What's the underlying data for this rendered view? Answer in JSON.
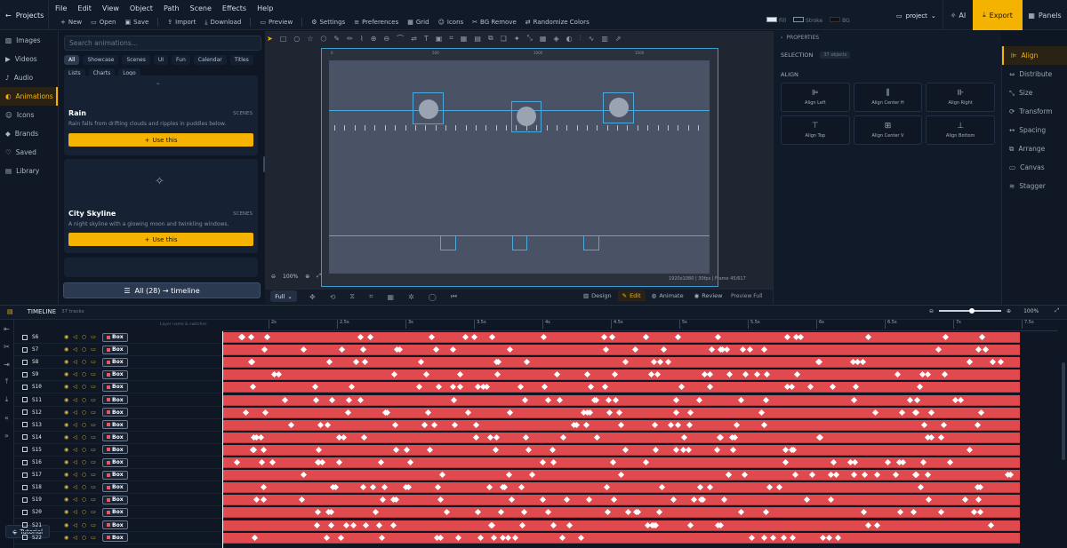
{
  "topbar": {
    "projects_label": "Projects",
    "menu": [
      "File",
      "Edit",
      "View",
      "Object",
      "Path",
      "Scene",
      "Effects",
      "Help"
    ],
    "toolbar": [
      {
        "icon": "plus-icon",
        "label": "New"
      },
      {
        "icon": "folder-icon",
        "label": "Open"
      },
      {
        "icon": "save-icon",
        "label": "Save"
      },
      {
        "icon": "upload-icon",
        "label": "Import"
      },
      {
        "icon": "download-icon",
        "label": "Download"
      },
      {
        "icon": "monitor-icon",
        "label": "Preview"
      },
      {
        "icon": "sliders-icon",
        "label": "Settings"
      },
      {
        "icon": "preferences-icon",
        "label": "Preferences"
      },
      {
        "icon": "grid-icon",
        "label": "Grid"
      },
      {
        "icon": "icons-icon",
        "label": "Icons"
      },
      {
        "icon": "bg-remove-icon",
        "label": "BG Remove"
      },
      {
        "icon": "shuffle-icon",
        "label": "Randomize Colors"
      }
    ],
    "fill_label": "Fill",
    "stroke_label": "Stroke",
    "bg_label": "BG",
    "project_select": "project",
    "ai_label": "AI",
    "export_label": "Export",
    "panels_label": "Panels"
  },
  "leftnav": [
    {
      "icon": "images-icon",
      "label": "Images"
    },
    {
      "icon": "videos-icon",
      "label": "Videos"
    },
    {
      "icon": "audio-icon",
      "label": "Audio"
    },
    {
      "icon": "animations-icon",
      "label": "Animations",
      "active": true
    },
    {
      "icon": "icons-icon",
      "label": "Icons"
    },
    {
      "icon": "brands-icon",
      "label": "Brands"
    },
    {
      "icon": "saved-icon",
      "label": "Saved"
    },
    {
      "icon": "library-icon",
      "label": "Library"
    }
  ],
  "animations": {
    "search_placeholder": "Search animations...",
    "chips": [
      "All",
      "Showcase",
      "Scenes",
      "UI",
      "Fun",
      "Calendar",
      "Titles",
      "Lists",
      "Charts",
      "Logo"
    ],
    "cards": [
      {
        "title": "Rain",
        "tag": "SCENES",
        "desc": "Rain falls from drifting clouds and ripples in puddles below.",
        "button": "Use this"
      },
      {
        "title": "City Skyline",
        "tag": "SCENES",
        "desc": "A night skyline with a glowing moon and twinkling windows.",
        "button": "Use this"
      }
    ],
    "all_button": "All (28) → timeline"
  },
  "canvas": {
    "ruler": [
      "0",
      "500",
      "1000",
      "1500"
    ],
    "zoom": "100%",
    "status": "1920x1080 | 30fps | Frame 45/617",
    "full_select": "Full",
    "modes": [
      {
        "icon": "design-icon",
        "label": "Design"
      },
      {
        "icon": "edit-icon",
        "label": "Edit",
        "active": true
      },
      {
        "icon": "animate-icon",
        "label": "Animate"
      },
      {
        "icon": "review-icon",
        "label": "Review"
      }
    ],
    "preview_full": "Preview Full"
  },
  "properties": {
    "header": "PROPERTIES",
    "selection_label": "SELECTION",
    "selection_badge": "37 objects",
    "align_label": "ALIGN",
    "align_buttons": [
      "Align Left",
      "Align Center H",
      "Align Right",
      "Align Top",
      "Align Center V",
      "Align Bottom"
    ]
  },
  "rightnav": [
    {
      "icon": "align-icon",
      "label": "Align",
      "active": true
    },
    {
      "icon": "distribute-icon",
      "label": "Distribute"
    },
    {
      "icon": "size-icon",
      "label": "Size"
    },
    {
      "icon": "transform-icon",
      "label": "Transform"
    },
    {
      "icon": "spacing-icon",
      "label": "Spacing"
    },
    {
      "icon": "arrange-icon",
      "label": "Arrange"
    },
    {
      "icon": "canvas-icon",
      "label": "Canvas"
    },
    {
      "icon": "stagger-icon",
      "label": "Stagger"
    }
  ],
  "timeline": {
    "title": "TIMELINE",
    "count": "37 tracks",
    "zoom": "100%",
    "layer_hint": "Layer name & switches",
    "ticks": [
      "2s",
      "2.5s",
      "3s",
      "3.5s",
      "4s",
      "4.5s",
      "5s",
      "5.5s",
      "6s",
      "6.5s",
      "7s",
      "7.5s"
    ],
    "layers": [
      "S6",
      "S7",
      "S8",
      "S9",
      "S10",
      "S11",
      "S12",
      "S13",
      "S14",
      "S15",
      "S16",
      "S17",
      "S18",
      "S19",
      "S20",
      "S21",
      "S22"
    ],
    "layer_type": "Box",
    "tutorial": "Tutorial"
  },
  "colors": {
    "accent": "#f5b301",
    "track": "#e04a4f",
    "selection": "#4aa9de"
  }
}
